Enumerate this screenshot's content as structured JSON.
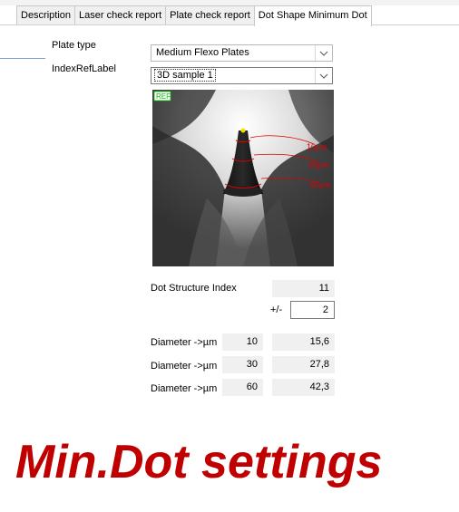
{
  "tabs": [
    {
      "label": "Description"
    },
    {
      "label": "Laser check report"
    },
    {
      "label": "Plate check report"
    },
    {
      "label": "Dot Shape Minimum Dot"
    }
  ],
  "form": {
    "plate_type_label": "Plate type",
    "plate_type_value": "Medium Flexo Plates",
    "index_ref_label": "IndexRefLabel",
    "index_ref_value": "3D sample 1"
  },
  "image": {
    "ref_tag": "REF",
    "annotations": [
      "10µm",
      "30µm",
      "60µm"
    ]
  },
  "dot_structure": {
    "label": "Dot Structure Index",
    "value": "11",
    "tolerance_label": "+/-",
    "tolerance_value": "2"
  },
  "diameters": [
    {
      "label": "Diameter ->µm",
      "depth": "10",
      "value": "15,6"
    },
    {
      "label": "Diameter ->µm",
      "depth": "30",
      "value": "27,8"
    },
    {
      "label": "Diameter ->µm",
      "depth": "60",
      "value": "42,3"
    }
  ],
  "caption": "Min.Dot settings",
  "colors": {
    "caption": "#c00000",
    "annotation": "#e00000",
    "ref_tag": "#00c000"
  }
}
